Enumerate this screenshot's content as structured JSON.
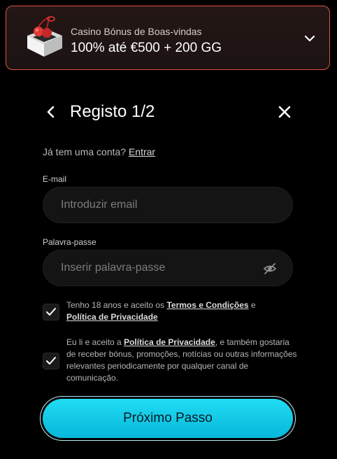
{
  "banner": {
    "subtitle": "Casino Bónus de Boas-vindas",
    "title": "100% até €500 + 200 GG",
    "icons": {
      "art": "cherry-box-icon",
      "expand": "chevron-down-icon"
    },
    "border_color": "#e0523e"
  },
  "header": {
    "title": "Registo 1/2",
    "icons": {
      "back": "chevron-left-icon",
      "close": "close-icon"
    }
  },
  "login_prompt": {
    "text": "Já tem uma conta?",
    "link": "Entrar"
  },
  "form": {
    "email": {
      "label": "E-mail",
      "value": "",
      "placeholder": "Introduzir email"
    },
    "password": {
      "label": "Palavra-passe",
      "value": "",
      "placeholder": "Inserir palavra-passe",
      "toggle_icon": "eye-off-icon"
    }
  },
  "consents": [
    {
      "checked": true,
      "text_before": "Tenho 18 anos e aceito os",
      "link1": "Termos e Condições",
      "text_middle": "e",
      "link2": "Política de Privacidade"
    },
    {
      "checked": true,
      "text_before": "Eu li e aceito a",
      "link": "Política de Privacidade",
      "text_after": ", e também gostaria de receber bónus, promoções, notícias ou outras informações relevantes periodicamente por qualquer canal de comunicação."
    }
  ],
  "actions": {
    "next_label": "Próximo Passo",
    "accent_color": "#22dcf3"
  }
}
